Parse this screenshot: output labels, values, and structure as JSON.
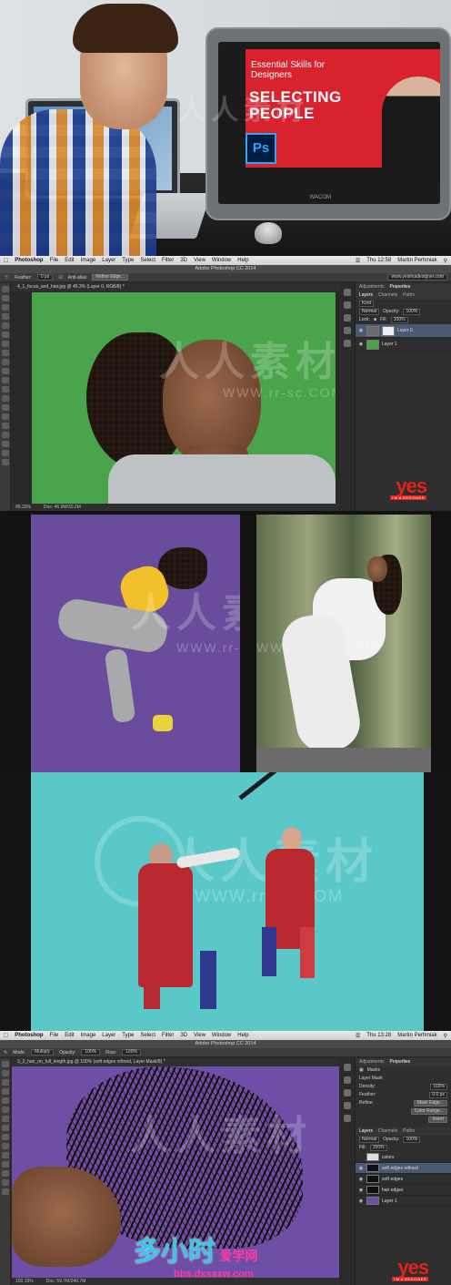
{
  "course": {
    "eyebrow": "Essential Skills for Designers",
    "title": "SELECTING PEOPLE",
    "logo": "Ps",
    "tablet_brand": "WACOM"
  },
  "ps_window_1": {
    "menu": [
      "Photoshop",
      "File",
      "Edit",
      "Image",
      "Layer",
      "Type",
      "Select",
      "Filter",
      "3D",
      "View",
      "Window",
      "Help"
    ],
    "clock": "Thu 12:58",
    "user": "Martin Perhiniak",
    "window_title": "Adobe Photoshop CC 2014",
    "options": {
      "feather_label": "Feather:",
      "feather_value": "0 px",
      "antialias_label": "Anti-alias",
      "refine_edge": "Refine Edge..."
    },
    "url_field": "www.yesimadesigner.com",
    "document_tab": "4_1_focus_and_hair.jpg @ 45.3% (Layer 0, RGB/8) *",
    "zoom": "45.33%",
    "doc_size": "Doc: 46.9M/30.2M",
    "panel_tabs": [
      "Adjustments",
      "Properties"
    ],
    "layer_tabs": [
      "Layers",
      "Channels",
      "Paths"
    ],
    "kind_label": "Kind",
    "blend_mode": "Normal",
    "opacity_label": "Opacity:",
    "opacity_value": "100%",
    "fill_label": "Fill:",
    "fill_value": "100%",
    "lock_label": "Lock:",
    "layers": [
      "Layer 0",
      "Layer 1"
    ]
  },
  "ps_window_2": {
    "clock": "Thu 13:28",
    "user": "Martin Perhiniak",
    "window_title": "Adobe Photoshop CC 2014",
    "options": {
      "mode_label": "Mode:",
      "mode_value": "Multiply",
      "opacity_label": "Opacity:",
      "opacity_value": "100%",
      "flow_label": "Flow:",
      "flow_value": "100%"
    },
    "document_tab": "3_2_hair_on_full_length.jpg @ 100% (soft edges refined, Layer Mask/8) *",
    "zoom": "100.19%",
    "doc_size": "Doc: 59.7M/240.7M",
    "panel_tabs": [
      "Adjustments",
      "Properties"
    ],
    "masks_title": "Masks",
    "layer_mask_label": "Layer Mask",
    "density_label": "Density:",
    "density_value": "100%",
    "feather_label": "Feather:",
    "feather_value": "0.0 px",
    "refine_label": "Refine:",
    "mask_edge_button": "Mask Edge...",
    "color_range_button": "Color Range...",
    "invert_button": "Invert",
    "layer_tabs": [
      "Layers",
      "Channels",
      "Paths"
    ],
    "blend_mode": "Normal",
    "opacity_label": "Opacity:",
    "opacity_value": "100%",
    "fill_label": "Fill:",
    "fill_value": "100%",
    "layers": [
      "colors",
      "soft edges refined",
      "soft edges",
      "hair edges",
      "Layer 1"
    ]
  },
  "branding": {
    "yes": "yes",
    "tagline": "I'M A DESIGNER"
  },
  "watermarks": {
    "cn_text": "人人素材",
    "url": "WWW.rr-sc.COM",
    "forum_name": "多小时",
    "forum_tag": "爱学网",
    "forum_url": "bbs.dxsaxw.com"
  },
  "colors": {
    "green_screen": "#4aa44b",
    "purple_bg": "#6a4c9c",
    "cyan_bg": "#5ac8c8",
    "brand_red": "#e3221b",
    "course_red": "#d8222e"
  }
}
